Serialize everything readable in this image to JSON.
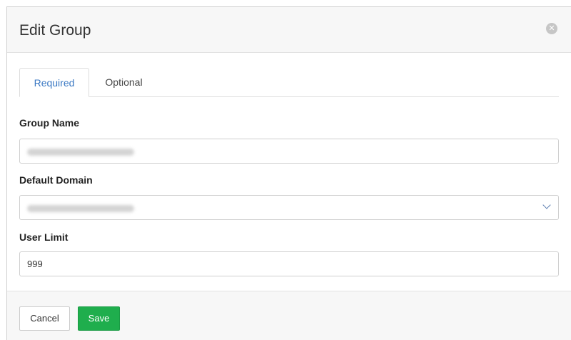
{
  "dialog": {
    "title": "Edit Group",
    "close_icon": "close-icon"
  },
  "tabs": [
    {
      "label": "Required",
      "active": true
    },
    {
      "label": "Optional",
      "active": false
    }
  ],
  "fields": {
    "group_name": {
      "label": "Group Name",
      "value": ""
    },
    "default_domain": {
      "label": "Default Domain",
      "value": "",
      "icon": "chevron-down-icon"
    },
    "user_limit": {
      "label": "User Limit",
      "value": "999"
    }
  },
  "footer": {
    "cancel_label": "Cancel",
    "save_label": "Save"
  },
  "colors": {
    "active_tab": "#3a78c3",
    "save_button": "#1fae4d"
  }
}
